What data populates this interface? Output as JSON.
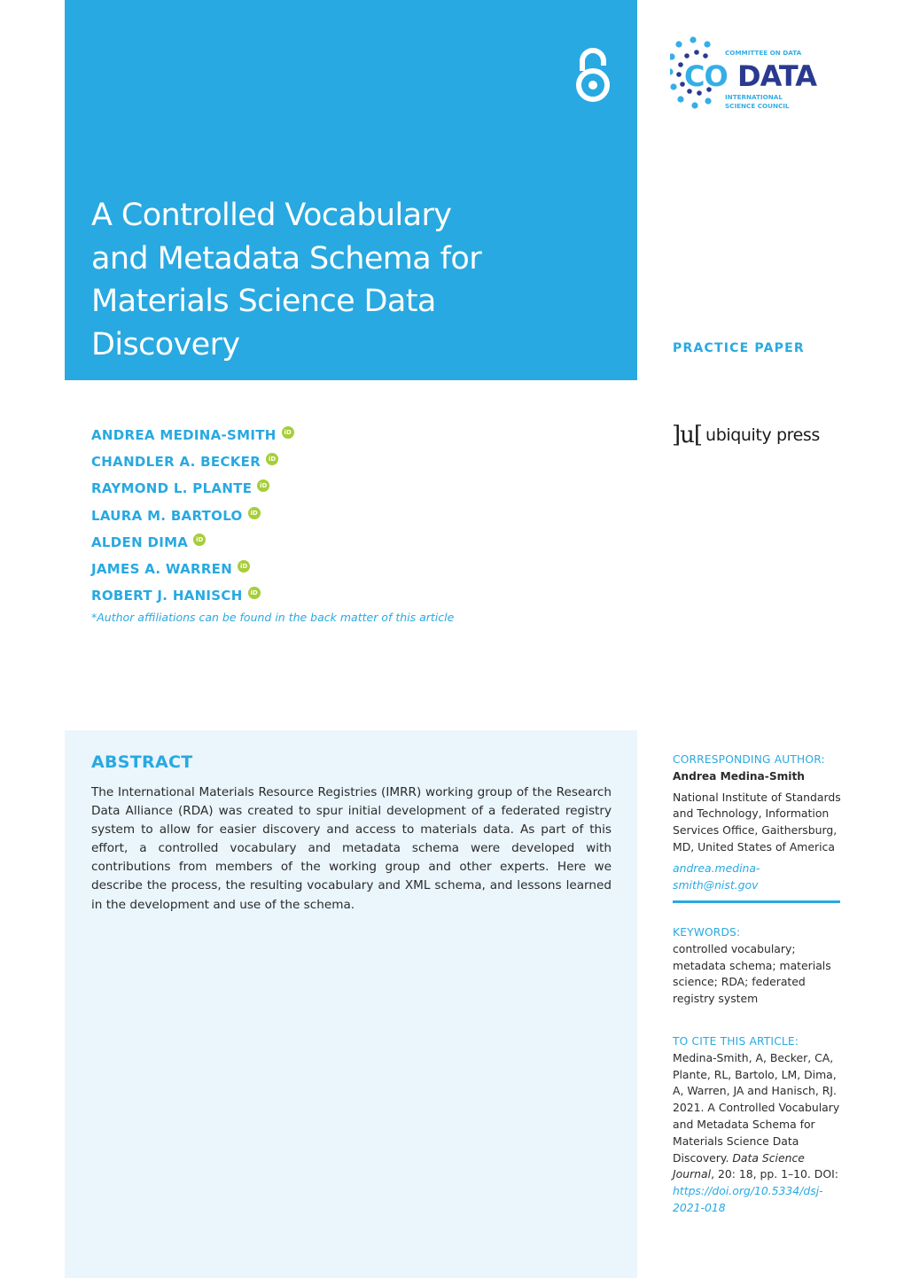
{
  "header": {
    "title_lines": [
      "A Controlled Vocabulary",
      "and Metadata Schema for",
      "Materials Science Data",
      "Discovery"
    ],
    "open_access_icon": "open-access-lock-icon",
    "brand_color": "#28a9e1"
  },
  "codata_logo": {
    "top_text": "COMMITTEE ON DATA",
    "co": "CO",
    "data": "DATA",
    "bottom_line1": "INTERNATIONAL",
    "bottom_line2": "SCIENCE COUNCIL"
  },
  "article_type": "PRACTICE PAPER",
  "authors": [
    {
      "name": "ANDREA MEDINA-SMITH",
      "orcid": "iD"
    },
    {
      "name": "CHANDLER A. BECKER",
      "orcid": "iD"
    },
    {
      "name": "RAYMOND L. PLANTE",
      "orcid": "iD"
    },
    {
      "name": "LAURA M. BARTOLO",
      "orcid": "iD"
    },
    {
      "name": "ALDEN DIMA",
      "orcid": "iD"
    },
    {
      "name": "JAMES A. WARREN",
      "orcid": "iD"
    },
    {
      "name": "ROBERT J. HANISCH",
      "orcid": "iD"
    }
  ],
  "affiliation_note": "*Author affiliations can be found in the back matter of this article",
  "publisher": {
    "mark": "]u[",
    "name": "ubiquity press"
  },
  "abstract": {
    "heading": "ABSTRACT",
    "body": "The International Materials Resource Registries (IMRR) working group of the Research Data Alliance (RDA) was created to spur initial development of a federated registry system to allow for easier discovery and access to materials data. As part of this effort, a controlled vocabulary and metadata schema were developed with contributions from members of the working group and other experts. Here we describe the process, the resulting vocabulary and XML schema, and lessons learned in the development and use of the schema."
  },
  "corresponding_author": {
    "label": "CORRESPONDING AUTHOR:",
    "name": "Andrea Medina-Smith",
    "address": "National Institute of Standards and Technology, Information Services Office, Gaithersburg, MD, United States of America",
    "email": "andrea.medina-smith@nist.gov"
  },
  "keywords": {
    "label": "KEYWORDS:",
    "text": "controlled vocabulary; metadata schema; materials science; RDA; federated registry system"
  },
  "citation": {
    "label": "TO CITE THIS ARTICLE:",
    "text_before_journal": "Medina-Smith, A, Becker, CA, Plante, RL, Bartolo, LM, Dima, A, Warren, JA and Hanisch, RJ. 2021. A Controlled Vocabulary and Metadata Schema for Materials Science Data Discovery. ",
    "journal": "Data Science Journal",
    "text_after_journal": ", 20: 18, pp. 1–10. DOI: ",
    "doi_link": "https://doi.org/10.5334/dsj-2021-018"
  }
}
